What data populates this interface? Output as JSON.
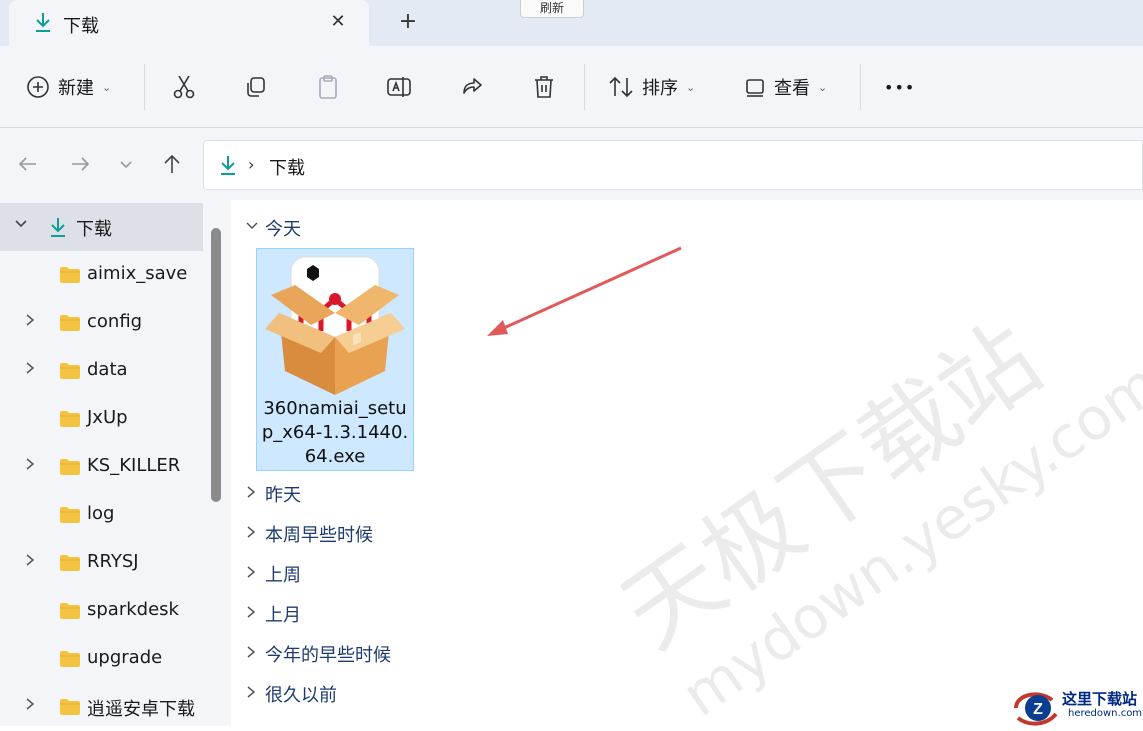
{
  "tab": {
    "title": "下载",
    "close_glyph": "✕",
    "new_glyph": "+"
  },
  "tooltip": {
    "text": "刷新"
  },
  "toolbar": {
    "new_label": "新建",
    "sort_label": "排序",
    "view_label": "查看",
    "more_glyph": "•••"
  },
  "address": {
    "path": "下载"
  },
  "sidebar": {
    "items": [
      {
        "label": "下载",
        "expand": "v",
        "selected": true
      },
      {
        "label": "aimix_save",
        "expand": ""
      },
      {
        "label": "config",
        "expand": ">"
      },
      {
        "label": "data",
        "expand": ">"
      },
      {
        "label": "JxUp",
        "expand": ""
      },
      {
        "label": "KS_KILLER",
        "expand": ">"
      },
      {
        "label": "log",
        "expand": ""
      },
      {
        "label": "RRYSJ",
        "expand": ">"
      },
      {
        "label": "sparkdesk",
        "expand": ""
      },
      {
        "label": "upgrade",
        "expand": ""
      },
      {
        "label": "逍遥安卓下载",
        "expand": ">"
      }
    ]
  },
  "groups": {
    "today": "今天",
    "yesterday": "昨天",
    "this_week": "本周早些时候",
    "last_week": "上周",
    "last_month": "上月",
    "this_year": "今年的早些时候",
    "long_ago": "很久以前"
  },
  "file": {
    "name_line1": "360namiai_setu",
    "name_line2": "p_x64-1.3.1440.",
    "name_line3": "64.exe"
  },
  "watermark": {
    "line1": "天极下载站",
    "line2": "mydown.yesky.com"
  },
  "corner_logo": {
    "title": "这里下载站",
    "sub": "heredown.com"
  },
  "colors": {
    "accent": "#0f9d9a",
    "folder": "#f5c342",
    "arrow": "#e05a5a",
    "selection": "#cde8ff"
  }
}
